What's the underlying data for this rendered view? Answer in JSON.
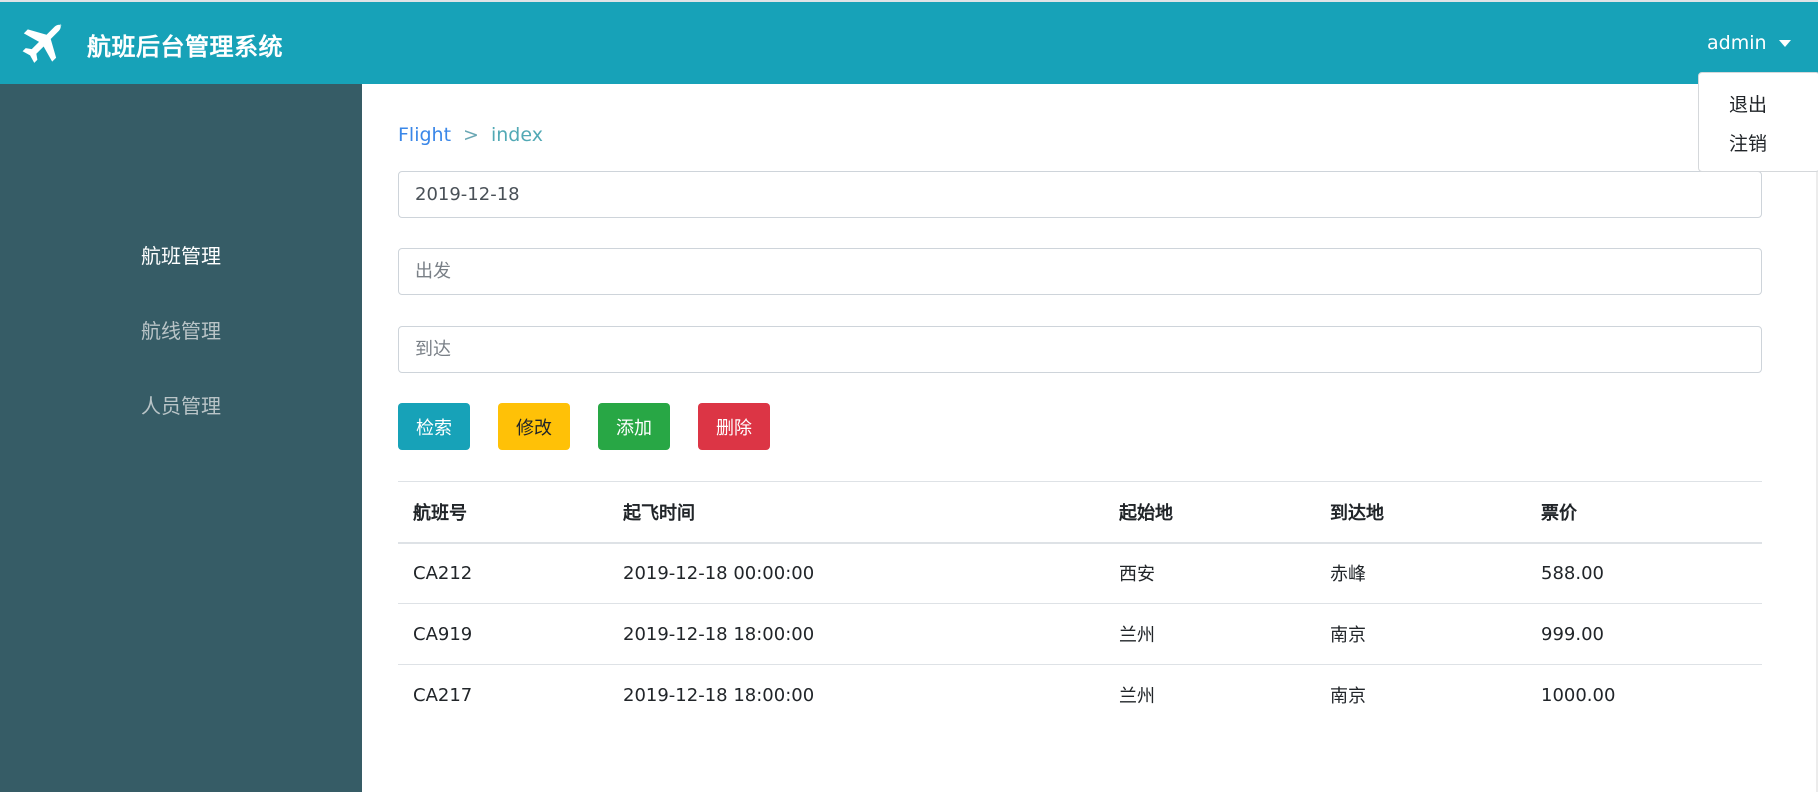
{
  "header": {
    "app_title": "航班后台管理系统",
    "logo_icon": "airplane-icon",
    "user_name": "admin",
    "user_menu": [
      "退出",
      "注销"
    ]
  },
  "sidebar": {
    "items": [
      {
        "label": "航班管理",
        "active": true
      },
      {
        "label": "航线管理",
        "active": false
      },
      {
        "label": "人员管理",
        "active": false
      }
    ]
  },
  "breadcrumb": {
    "root": "Flight",
    "separator": ">",
    "current": "index"
  },
  "search_form": {
    "date_value": "2019-12-18",
    "departure_placeholder": "出发",
    "arrival_placeholder": "到达"
  },
  "buttons": {
    "search": "检索",
    "edit": "修改",
    "add": "添加",
    "delete": "删除"
  },
  "colors": {
    "primary": "#17a2b8",
    "sidebar": "#365c66",
    "warning": "#ffc107",
    "success": "#28a745",
    "danger": "#dc3545"
  },
  "table": {
    "columns": [
      "航班号",
      "起飞时间",
      "起始地",
      "到达地",
      "票价"
    ],
    "rows": [
      [
        "CA212",
        "2019-12-18 00:00:00",
        "西安",
        "赤峰",
        "588.00"
      ],
      [
        "CA919",
        "2019-12-18 18:00:00",
        "兰州",
        "南京",
        "999.00"
      ],
      [
        "CA217",
        "2019-12-18 18:00:00",
        "兰州",
        "南京",
        "1000.00"
      ]
    ]
  }
}
